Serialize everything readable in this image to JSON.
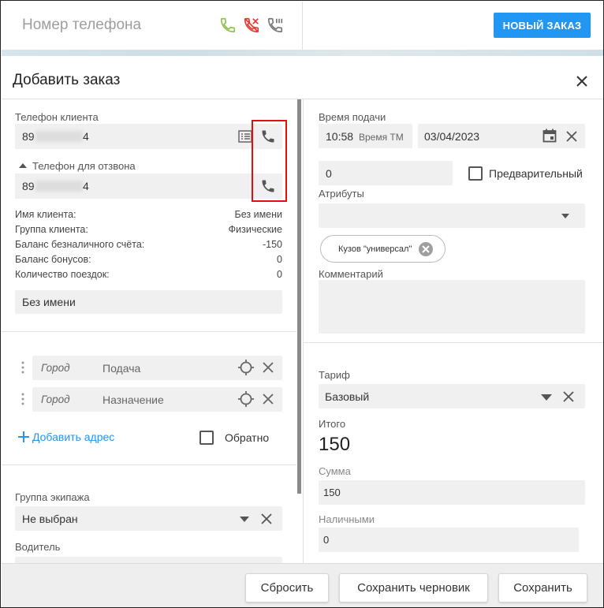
{
  "topbar": {
    "phone_placeholder": "Номер телефона",
    "new_order_label": "НОВЫЙ ЗАКАЗ",
    "colors": {
      "accent": "#2196f3",
      "call_green": "#8bc34a",
      "hangup_red": "#e53935"
    }
  },
  "modal": {
    "title": "Добавить заказ"
  },
  "client": {
    "phone_label": "Телефон клиента",
    "phone_prefix": "89",
    "phone_suffix": "4",
    "callback_label": "Телефон для отзвона",
    "callback_prefix": "89",
    "callback_suffix": "4",
    "info": [
      {
        "key": "Имя клиента:",
        "value": "Без имени"
      },
      {
        "key": "Группа клиента:",
        "value": "Физические"
      },
      {
        "key": "Баланс безналичного счёта:",
        "value": "-150"
      },
      {
        "key": "Баланс бонусов:",
        "value": "0"
      },
      {
        "key": "Количество поездок:",
        "value": "0"
      }
    ],
    "name_value": "Без имени"
  },
  "addresses": [
    {
      "city_placeholder": "Город",
      "placeholder": "Подача"
    },
    {
      "city_placeholder": "Город",
      "placeholder": "Назначение"
    }
  ],
  "add_address_label": "Добавить адрес",
  "return_label": "Обратно",
  "crew": {
    "group_label": "Группа экипажа",
    "group_value": "Не выбран",
    "driver_label": "Водитель"
  },
  "timing": {
    "label": "Время подачи",
    "time": "10:58",
    "time_zone": "Время ТМ",
    "date": "03/04/2023",
    "minutes_value": "0",
    "preliminary_label": "Предварительный"
  },
  "attributes": {
    "label": "Атрибуты",
    "chip": "Кузов \"универсал\""
  },
  "comment_label": "Комментарий",
  "tariff": {
    "label": "Тариф",
    "value": "Базовый"
  },
  "total": {
    "label": "Итого",
    "value": "150"
  },
  "sum": {
    "label": "Сумма",
    "value": "150"
  },
  "cash": {
    "label": "Наличными",
    "value": "0"
  },
  "footer": {
    "reset_label": "Сбросить",
    "save_draft_label": "Сохранить черновик",
    "save_label": "Сохранить"
  }
}
